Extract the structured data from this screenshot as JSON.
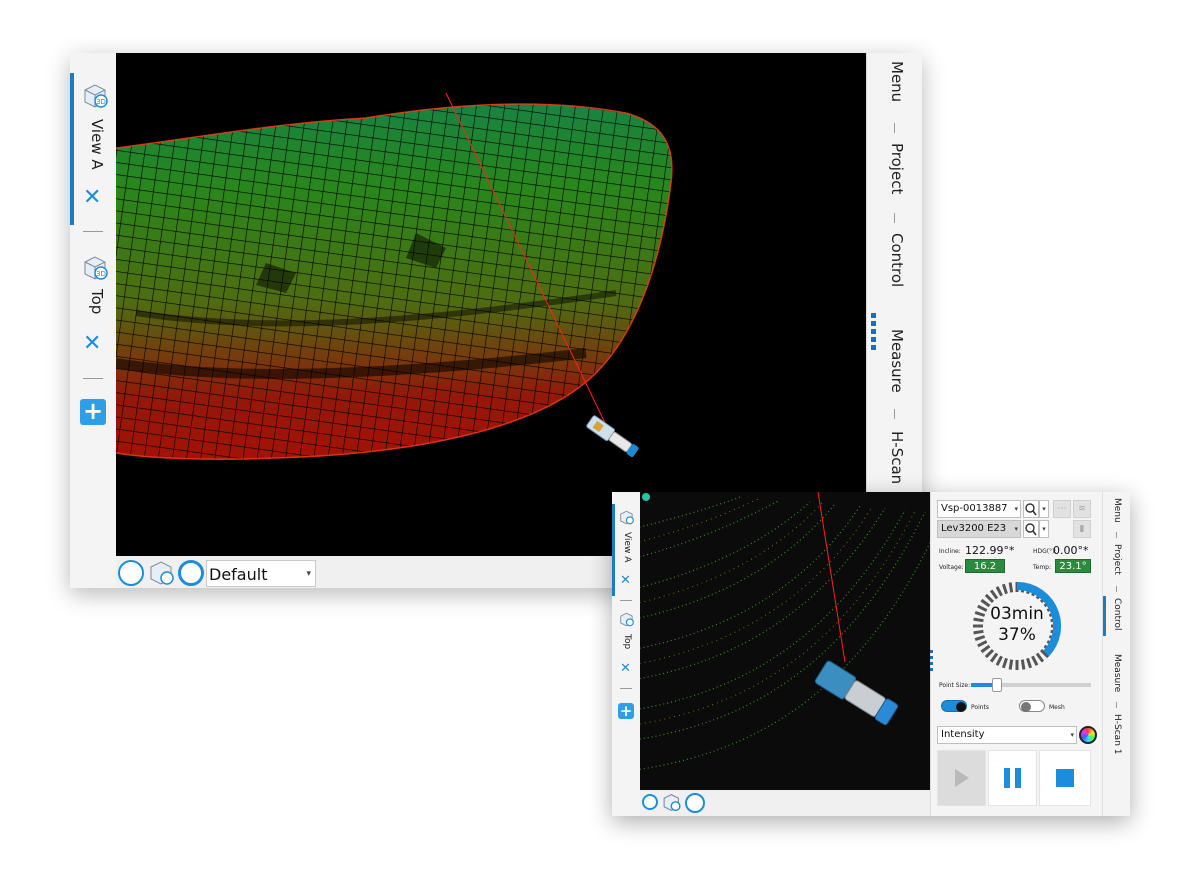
{
  "main_window": {
    "view_tabs": [
      {
        "label": "View A",
        "active": true
      },
      {
        "label": "Top",
        "active": false
      }
    ],
    "close_symbol": "✕",
    "add_symbol": "+",
    "preset": {
      "value": "Default"
    },
    "side_menu": [
      "Menu",
      "Project",
      "Control",
      "Measure",
      "H-Scan"
    ]
  },
  "scanner_window": {
    "view_tabs": [
      {
        "label": "View A",
        "active": true
      },
      {
        "label": "Top",
        "active": false
      }
    ],
    "close_symbol": "✕",
    "add_symbol": "+",
    "side_menu": [
      "Menu",
      "Project",
      "Control",
      "Measure",
      "H-Scan 1"
    ],
    "device": {
      "scanner": "Vsp-0013887",
      "model": "Lev3200 E23"
    },
    "readings": {
      "incline_label": "Incline:",
      "incline_value": "122.99°*",
      "hdg_label": "HDG(°):",
      "hdg_value": "0.00°*",
      "voltage_label": "Voltage:",
      "voltage_value": "16.2",
      "temp_label": "Temp:",
      "temp_value": "23.1°"
    },
    "progress": {
      "time": "03min",
      "percent_text": "37%",
      "fraction": 0.37
    },
    "point_size": {
      "label": "Point Size:",
      "fraction": 0.22
    },
    "toggles": {
      "points_label": "Points",
      "points_on": true,
      "mesh_label": "Mesh",
      "mesh_on": false
    },
    "color_mode": {
      "value": "Intensity"
    },
    "colors": {
      "accent": "#1c8ddb",
      "ok_green": "#2b8a3e",
      "viewport": "#000000"
    },
    "icons": [
      "search-icon",
      "wifi-icon",
      "play-icon",
      "pause-icon",
      "stop-icon",
      "color-wheel-icon"
    ]
  }
}
